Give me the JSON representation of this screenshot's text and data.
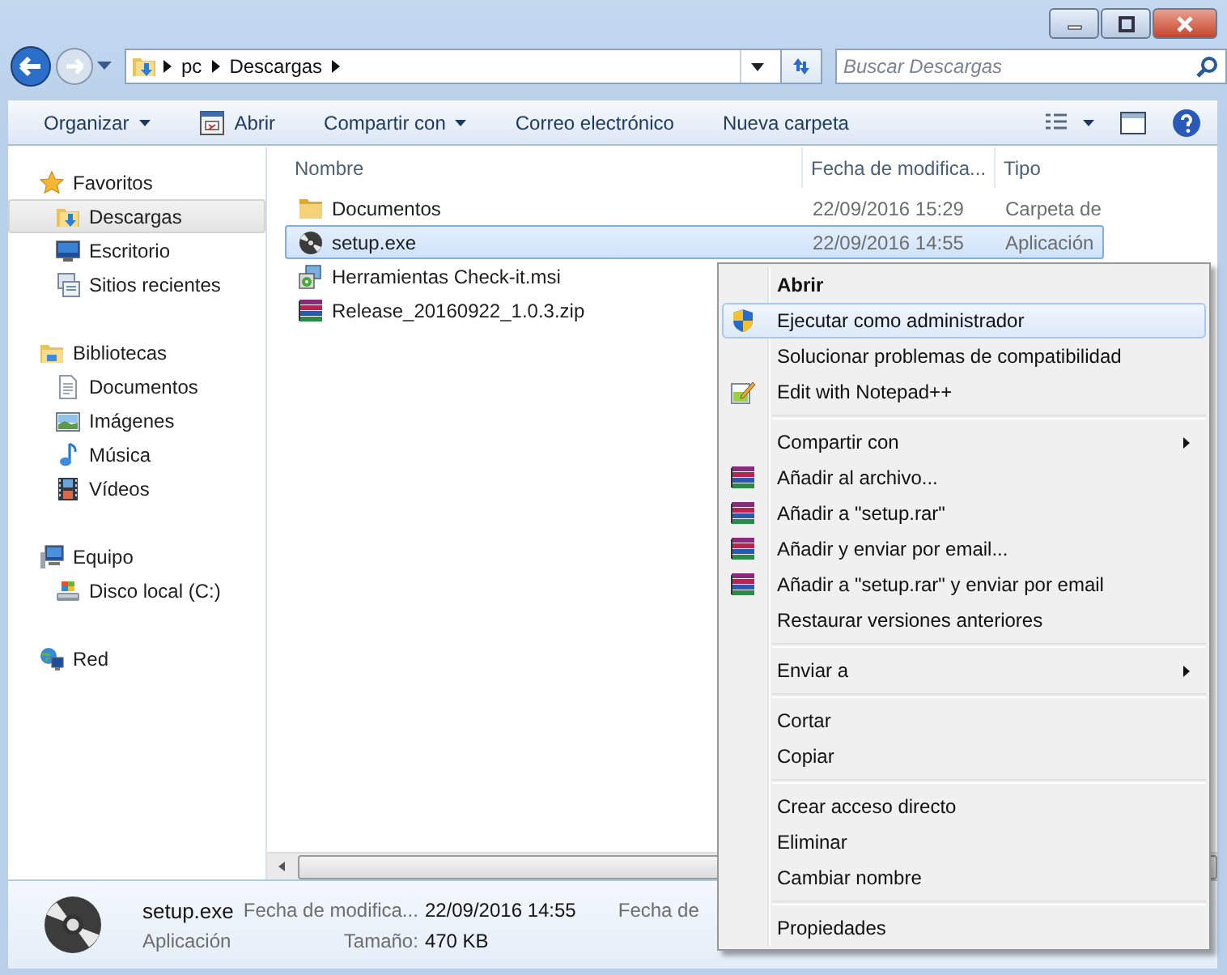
{
  "address": {
    "path": [
      "pc",
      "Descargas"
    ]
  },
  "search": {
    "placeholder": "Buscar Descargas"
  },
  "toolbar": [
    {
      "label": "Organizar",
      "dropdown": true
    },
    {
      "label": "Abrir",
      "dropdown": false
    },
    {
      "label": "Compartir con",
      "dropdown": true
    },
    {
      "label": "Correo electrónico",
      "dropdown": false
    },
    {
      "label": "Nueva carpeta",
      "dropdown": false
    }
  ],
  "sidebar": [
    {
      "label": "Favoritos",
      "selected": false,
      "children": [
        {
          "label": "Descargas",
          "selected": true
        },
        {
          "label": "Escritorio",
          "selected": false
        },
        {
          "label": "Sitios recientes",
          "selected": false
        }
      ]
    },
    {
      "label": "Bibliotecas",
      "selected": false,
      "children": [
        {
          "label": "Documentos",
          "selected": false
        },
        {
          "label": "Imágenes",
          "selected": false
        },
        {
          "label": "Música",
          "selected": false
        },
        {
          "label": "Vídeos",
          "selected": false
        }
      ]
    },
    {
      "label": "Equipo",
      "selected": false,
      "children": [
        {
          "label": "Disco local (C:)",
          "selected": false
        }
      ]
    },
    {
      "label": "Red",
      "selected": false
    }
  ],
  "file_list": {
    "columns": [
      "Nombre",
      "Fecha de modifica...",
      "Tipo"
    ],
    "rows": [
      {
        "name": "Documentos",
        "date": "22/09/2016 15:29",
        "type": "Carpeta de",
        "selected": false
      },
      {
        "name": "setup.exe",
        "date": "22/09/2016 14:55",
        "type": "Aplicación",
        "selected": true
      },
      {
        "name": "Herramientas Check-it.msi",
        "selected": false
      },
      {
        "name": "Release_20160922_1.0.3.zip",
        "selected": false
      }
    ]
  },
  "details": {
    "name": "setup.exe",
    "type": "Aplicación",
    "fields": [
      {
        "label": "Fecha de modifica...",
        "value": "22/09/2016 14:55"
      },
      {
        "label": "Tamaño:",
        "value": "470 KB"
      },
      {
        "label": "Fecha de"
      }
    ]
  },
  "context_menu": [
    {
      "kind": "item",
      "label": "Abrir",
      "default": true,
      "selected": false,
      "submenu": false
    },
    {
      "kind": "item",
      "label": "Ejecutar como administrador",
      "default": false,
      "selected": true,
      "submenu": false
    },
    {
      "kind": "item",
      "label": "Solucionar problemas de compatibilidad",
      "default": false,
      "selected": false,
      "submenu": false
    },
    {
      "kind": "item",
      "label": "Edit with Notepad++",
      "default": false,
      "selected": false,
      "submenu": false
    },
    {
      "kind": "separator"
    },
    {
      "kind": "item",
      "label": "Compartir con",
      "default": false,
      "selected": false,
      "submenu": true
    },
    {
      "kind": "item",
      "label": "Añadir al archivo...",
      "default": false,
      "selected": false,
      "submenu": false
    },
    {
      "kind": "item",
      "label": "Añadir a \"setup.rar\"",
      "default": false,
      "selected": false,
      "submenu": false
    },
    {
      "kind": "item",
      "label": "Añadir y enviar por email...",
      "default": false,
      "selected": false,
      "submenu": false
    },
    {
      "kind": "item",
      "label": "Añadir a \"setup.rar\" y enviar por email",
      "default": false,
      "selected": false,
      "submenu": false
    },
    {
      "kind": "item",
      "label": "Restaurar versiones anteriores",
      "default": false,
      "selected": false,
      "submenu": false
    },
    {
      "kind": "separator"
    },
    {
      "kind": "item",
      "label": "Enviar a",
      "default": false,
      "selected": false,
      "submenu": true
    },
    {
      "kind": "separator"
    },
    {
      "kind": "item",
      "label": "Cortar",
      "default": false,
      "selected": false,
      "submenu": false
    },
    {
      "kind": "item",
      "label": "Copiar",
      "default": false,
      "selected": false,
      "submenu": false
    },
    {
      "kind": "separator"
    },
    {
      "kind": "item",
      "label": "Crear acceso directo",
      "default": false,
      "selected": false,
      "submenu": false
    },
    {
      "kind": "item",
      "label": "Eliminar",
      "default": false,
      "selected": false,
      "submenu": false
    },
    {
      "kind": "item",
      "label": "Cambiar nombre",
      "default": false,
      "selected": false,
      "submenu": false
    },
    {
      "kind": "separator"
    },
    {
      "kind": "item",
      "label": "Propiedades",
      "default": false,
      "selected": false,
      "submenu": false
    }
  ]
}
